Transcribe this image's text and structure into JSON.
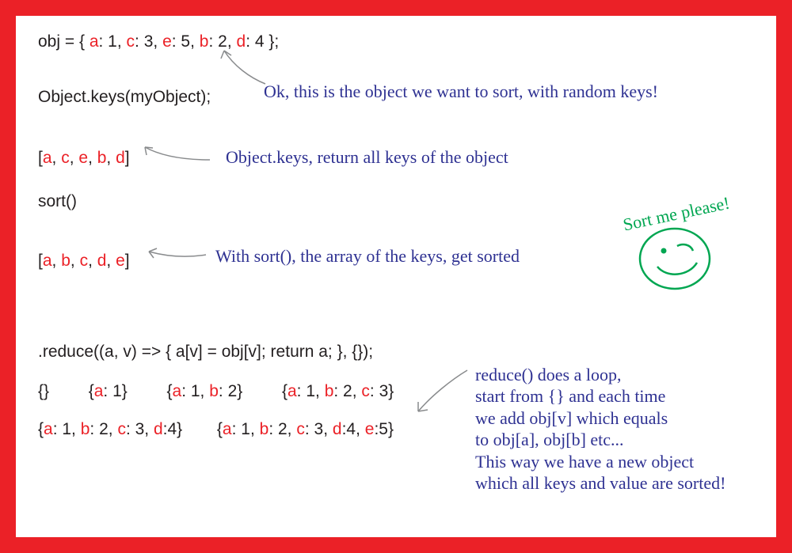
{
  "line1": {
    "pre": "obj = { ",
    "k1": "a",
    "v1": ": 1, ",
    "k2": "c",
    "v2": ": 3, ",
    "k3": "e",
    "v3": ": 5, ",
    "k4": "b",
    "v4": ": 2, ",
    "k5": "d",
    "v5": ": 4 };"
  },
  "line2": "Object.keys(myObject);",
  "annot1": "Ok, this is the object we want to sort, with random keys!",
  "arr1": {
    "open": "[",
    "k1": "a",
    "c1": ", ",
    "k2": "c",
    "c2": ", ",
    "k3": "e",
    "c3": ", ",
    "k4": "b",
    "c4": ", ",
    "k5": "d",
    "close": "]"
  },
  "annot2": "Object.keys, return all keys of the object",
  "line4": "sort()",
  "arr2": {
    "open": "[",
    "k1": "a",
    "c1": ", ",
    "k2": "b",
    "c2": ", ",
    "k3": "c",
    "c3": ", ",
    "k4": "d",
    "c4": ", ",
    "k5": "e",
    "close": "]"
  },
  "annot3": "With sort(), the array of the keys, get sorted",
  "doodle_text": "Sort me please!",
  "line6": ".reduce((a, v) => { a[v] = obj[v]; return a; }, {});",
  "steps": {
    "s0": "{}",
    "s1_open": "{",
    "s1_k1": "a",
    "s1_v1": ": 1}",
    "s2_open": "{",
    "s2_k1": "a",
    "s2_v1": ": 1, ",
    "s2_k2": "b",
    "s2_v2": ": 2}",
    "s3_open": "{",
    "s3_k1": "a",
    "s3_v1": ": 1, ",
    "s3_k2": "b",
    "s3_v2": ": 2, ",
    "s3_k3": "c",
    "s3_v3": ": 3}",
    "s4_open": "{",
    "s4_k1": "a",
    "s4_v1": ": 1, ",
    "s4_k2": "b",
    "s4_v2": ": 2, ",
    "s4_k3": "c",
    "s4_v3": ": 3, ",
    "s4_k4": "d",
    "s4_v4": ":4}",
    "s5_open": "{",
    "s5_k1": "a",
    "s5_v1": ": 1, ",
    "s5_k2": "b",
    "s5_v2": ": 2, ",
    "s5_k3": "c",
    "s5_v3": ": 3, ",
    "s5_k4": "d",
    "s5_v4": ":4, ",
    "s5_k5": "e",
    "s5_v5": ":5}"
  },
  "annot4": "reduce() does  a loop,\nstart from {} and each time\nwe add obj[v] which equals\nto obj[a], obj[b] etc...\nThis way we have a new object\nwhich all keys and value are sorted!"
}
